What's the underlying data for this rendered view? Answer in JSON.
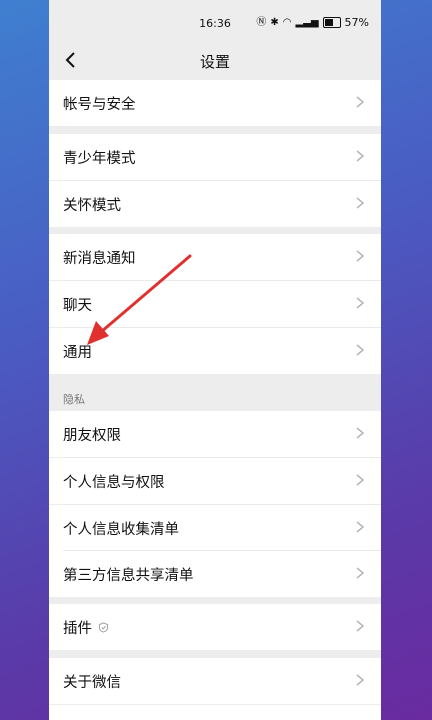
{
  "status": {
    "time": "16:36",
    "battery": "57%",
    "battery_level": 0.57
  },
  "nav": {
    "title": "设置"
  },
  "items": {
    "account": "帐号与安全",
    "teen": "青少年模式",
    "care": "关怀模式",
    "notify": "新消息通知",
    "chat": "聊天",
    "general": "通用",
    "friends": "朋友权限",
    "personal_info": "个人信息与权限",
    "info_collect": "个人信息收集清单",
    "third_party": "第三方信息共享清单",
    "plugins": "插件",
    "about": "关于微信"
  },
  "sections": {
    "privacy": "隐私"
  },
  "colors": {
    "arrow": "#e0312f"
  }
}
